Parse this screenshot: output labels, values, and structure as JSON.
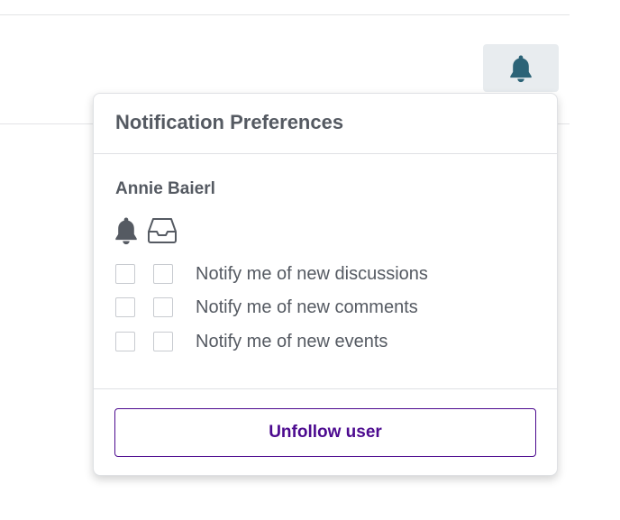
{
  "colors": {
    "accent": "#4c0a8f",
    "bell_button_bg": "#e8ecef",
    "bell_icon": "#2c6377",
    "text": "#555a62"
  },
  "header": {
    "bell_button_icon": "bell-icon"
  },
  "popover": {
    "title": "Notification Preferences",
    "user_name": "Annie Baierl",
    "column_icons": [
      "bell-icon",
      "inbox-icon"
    ],
    "preferences": [
      {
        "label": "Notify me of new discussions",
        "popup_checked": false,
        "email_checked": false
      },
      {
        "label": "Notify me of new comments",
        "popup_checked": false,
        "email_checked": false
      },
      {
        "label": "Notify me of new events",
        "popup_checked": false,
        "email_checked": false
      }
    ],
    "unfollow_label": "Unfollow user"
  }
}
